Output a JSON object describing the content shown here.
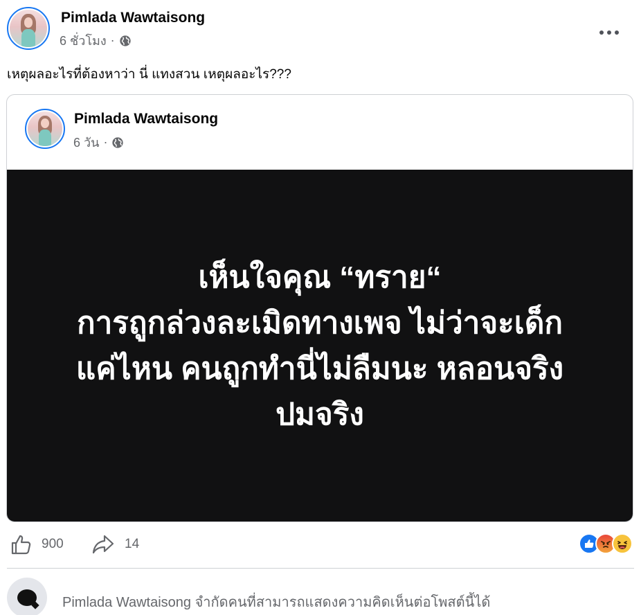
{
  "post": {
    "author": "Pimlada Wawtaisong",
    "time": "6 ชั่วโมง",
    "separator": "·",
    "privacy_icon": "globe-icon",
    "more_icon": "more-horizontal-icon",
    "text": "เหตุผลอะไรที่ต้องหาว่า นี่ แทงสวน เหตุผลอะไร???"
  },
  "shared_post": {
    "author": "Pimlada Wawtaisong",
    "time": "6 วัน",
    "separator": "·",
    "privacy_icon": "globe-icon",
    "image_text_lines": [
      "เห็นใจคุณ “ทราย“",
      "การถูกล่วงละเมิดทางเพจ ไม่ว่าจะเด็ก",
      "แค่ไหน คนถูกทำนี่ไม่ลืมนะ หลอนจริง",
      "ปมจริง"
    ]
  },
  "actions": {
    "like_icon": "like-icon",
    "like_count": "900",
    "share_icon": "share-icon",
    "share_count": "14",
    "reactions": [
      "like-reaction-icon",
      "angry-reaction-icon",
      "haha-reaction-icon"
    ]
  },
  "comments": {
    "restriction_text": "Pimlada Wawtaisong จำกัดคนที่สามารถแสดงความคิดเห็นต่อโพสต์นี้ได้"
  },
  "colors": {
    "accent": "#1877f2",
    "secondary_text": "#65676b",
    "image_bg": "#111112",
    "angry": "#f06a2a",
    "haha": "#f7c33c"
  }
}
